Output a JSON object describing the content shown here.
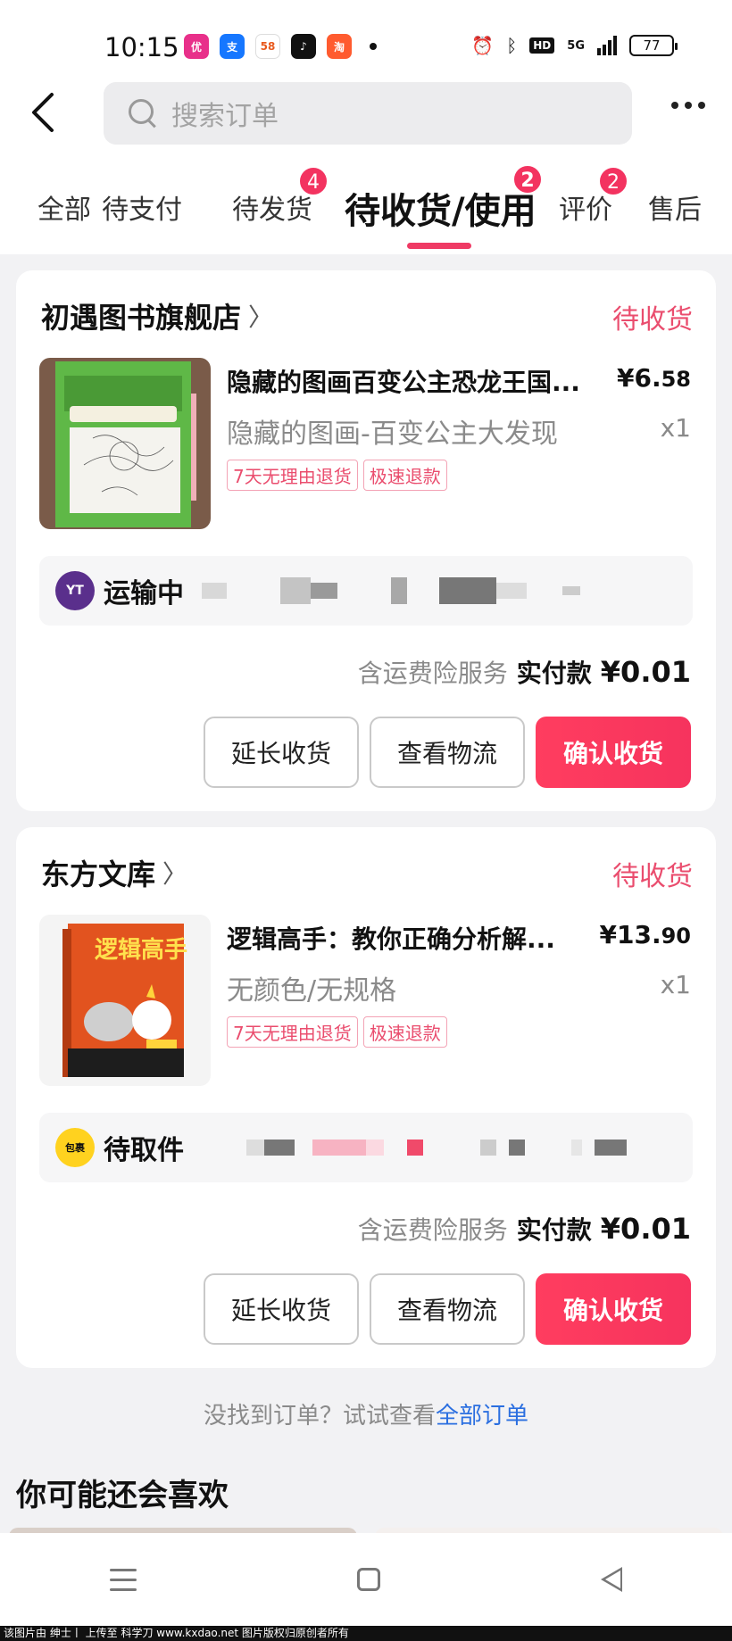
{
  "status_bar": {
    "time": "10:15",
    "network": "5G",
    "battery": "77",
    "apps": [
      {
        "name": "pinduoduo-app-icon",
        "color": "#e8308a",
        "label": "优"
      },
      {
        "name": "alipay-app-icon",
        "color": "#1677ff",
        "label": "支"
      },
      {
        "name": "58-app-icon",
        "color": "#ffffff",
        "label": "58"
      },
      {
        "name": "douyin-app-icon",
        "color": "#111111",
        "label": "♪"
      },
      {
        "name": "taobao-special-app-icon",
        "color": "#ff5b2f",
        "label": "淘"
      }
    ]
  },
  "header": {
    "search_placeholder": "搜索订单"
  },
  "tabs": [
    {
      "label": "全部",
      "badge": ""
    },
    {
      "label": "待支付",
      "badge": ""
    },
    {
      "label": "待发货",
      "badge": "4"
    },
    {
      "label": "待收货/使用",
      "badge": "2"
    },
    {
      "label": "评价",
      "badge": "2"
    },
    {
      "label": "售后",
      "badge": ""
    }
  ],
  "orders": [
    {
      "store": "初遇图书旗舰店",
      "status": "待收货",
      "product_title": "隐藏的图画百变公主恐龙王国...",
      "price_main": "¥6.",
      "price_cents": "58",
      "spec": "隐藏的图画-百变公主大发现",
      "qty": "x1",
      "tags": [
        "7天无理由退货",
        "极速退款"
      ],
      "logistics_status": "运输中",
      "carrier": "YT",
      "insurance": "含运费险服务",
      "pay_label": "实付款",
      "pay_amount": "¥0.01",
      "actions": [
        "延长收货",
        "查看物流",
        "确认收货"
      ]
    },
    {
      "store": "东方文库",
      "status": "待收货",
      "product_title": "逻辑高手：教你正确分析解...",
      "price_main": "¥13.",
      "price_cents": "90",
      "spec": "无颜色/无规格",
      "qty": "x1",
      "tags": [
        "7天无理由退货",
        "极速退款"
      ],
      "logistics_status": "待取件",
      "carrier": "包裹",
      "insurance": "含运费险服务",
      "pay_label": "实付款",
      "pay_amount": "¥0.01",
      "actions": [
        "延长收货",
        "查看物流",
        "确认收货"
      ]
    }
  ],
  "footer": {
    "not_found_prefix": "没找到订单？试试查看",
    "not_found_link": "全部订单",
    "recommend_title": "你可能还会喜欢"
  },
  "watermark": "该图片由 绅士丨 上传至 科学刀 www.kxdao.net 图片版权归原创者所有",
  "colors": {
    "accent": "#f6335e",
    "status_pink": "#ea4d6e",
    "link_blue": "#2b6fe0"
  }
}
